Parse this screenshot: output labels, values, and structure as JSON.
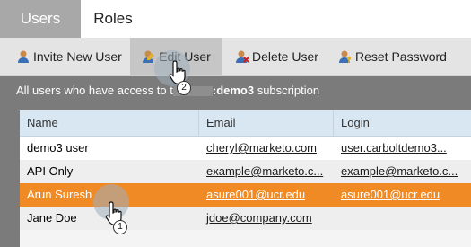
{
  "tabs": [
    {
      "label": "Users",
      "active": true
    },
    {
      "label": "Roles",
      "active": false
    }
  ],
  "toolbar": {
    "invite": "Invite New User",
    "edit": "Edit User",
    "delete": "Delete User",
    "reset": "Reset Password"
  },
  "caption": {
    "prefix": "All users who have access to t",
    "subscription": ":demo3",
    "suffix": " subscription"
  },
  "table": {
    "headers": [
      "Name",
      "Email",
      "Login"
    ],
    "rows": [
      {
        "name": "demo3 user",
        "email": "cheryl@marketo.com",
        "login": "user.carboltdemo3..."
      },
      {
        "name": "API Only",
        "email": "example@marketo.c...",
        "login": "example@marketo.c..."
      },
      {
        "name": "Arun Suresh",
        "email": "asure001@ucr.edu",
        "login": "asure001@ucr.edu"
      },
      {
        "name": "Jane Doe",
        "email": "jdoe@company.com",
        "login": ""
      }
    ],
    "selected_row": 2
  },
  "annotations": {
    "step1": "1",
    "step2": "2"
  },
  "colors": {
    "selected": "#f08a24",
    "header": "#d9e7f3",
    "tab_active": "#a8a8a8"
  }
}
